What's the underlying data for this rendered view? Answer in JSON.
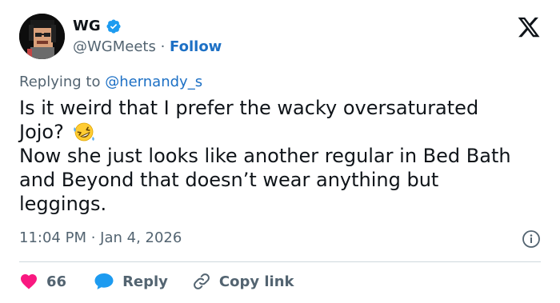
{
  "author": {
    "display_name": "WG",
    "handle": "@WGMeets",
    "separator": " · ",
    "follow_label": "Follow"
  },
  "reply": {
    "prefix": "Replying to ",
    "to": "@hernandy_s"
  },
  "tweet": {
    "lines": [
      "Is it weird that I prefer the wacky oversaturated",
      "Jojo?",
      "Now she just looks like another regular in Bed Bath",
      "and Beyond that doesn’t wear anything but",
      "leggings."
    ]
  },
  "meta": {
    "timestamp": "11:04 PM · Jan 4, 2026"
  },
  "actions": {
    "likes_count": "66",
    "reply_label": "Reply",
    "copy_link_label": "Copy link"
  },
  "icons": {
    "verified": "verified-badge-icon",
    "x_logo": "x-logo-icon",
    "emoji": "rolling-on-floor-laughing-emoji",
    "info": "info-icon",
    "like": "heart-icon",
    "reply": "speech-bubble-icon",
    "copy_link": "link-icon"
  },
  "colors": {
    "accent_blue": "#1d9bf0",
    "link_blue": "#1d70c5",
    "like_red": "#f91880",
    "secondary_text": "#536471"
  }
}
